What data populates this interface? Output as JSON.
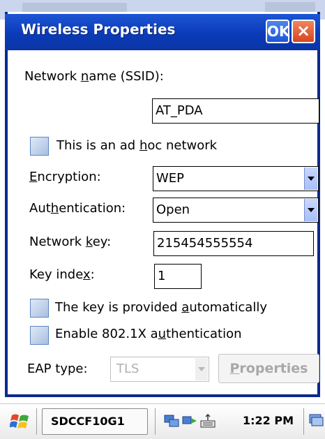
{
  "window": {
    "title": "Wireless Properties",
    "ok_label": "OK",
    "close_label": "×"
  },
  "form": {
    "ssid_label_pre": "Network ",
    "ssid_label_u": "n",
    "ssid_label_post": "ame (SSID):",
    "ssid_value": "AT_PDA",
    "adhoc_pre": "This is an ad ",
    "adhoc_u": "h",
    "adhoc_post": "oc network",
    "adhoc_checked": false,
    "encryption_u": "E",
    "encryption_post": "ncryption:",
    "encryption_value": "WEP",
    "auth_pre": "Aut",
    "auth_u": "h",
    "auth_post": "entication:",
    "auth_value": "Open",
    "netkey_pre": "Network ",
    "netkey_u": "k",
    "netkey_post": "ey:",
    "netkey_value": "215454555554",
    "keyindex_pre": "Key inde",
    "keyindex_u": "x",
    "keyindex_post": ":",
    "keyindex_value": "1",
    "autokey_pre": "The key is provided ",
    "autokey_u": "a",
    "autokey_post": "utomatically",
    "autokey_checked": false,
    "dot1x_pre": "Enable 802.1X a",
    "dot1x_u": "u",
    "dot1x_post": "thentication",
    "dot1x_checked": false,
    "eap_label": "EAP type:",
    "eap_value": "TLS",
    "properties_label_u": "P",
    "properties_label_post": "roperties"
  },
  "taskbar": {
    "task_label": "SDCCF10G1",
    "time": "1:22 PM"
  },
  "colors": {
    "titlebar": "#0b3bb8",
    "dialog_border": "#0a2a8e",
    "close_button": "#d64521",
    "checkbox": "#a8bfe0"
  },
  "icons": [
    "windows-start-icon",
    "network-tray-icon",
    "connection-tray-icon",
    "keyboard-tray-icon",
    "desktop-tray-icon",
    "dropdown-arrow-icon"
  ]
}
